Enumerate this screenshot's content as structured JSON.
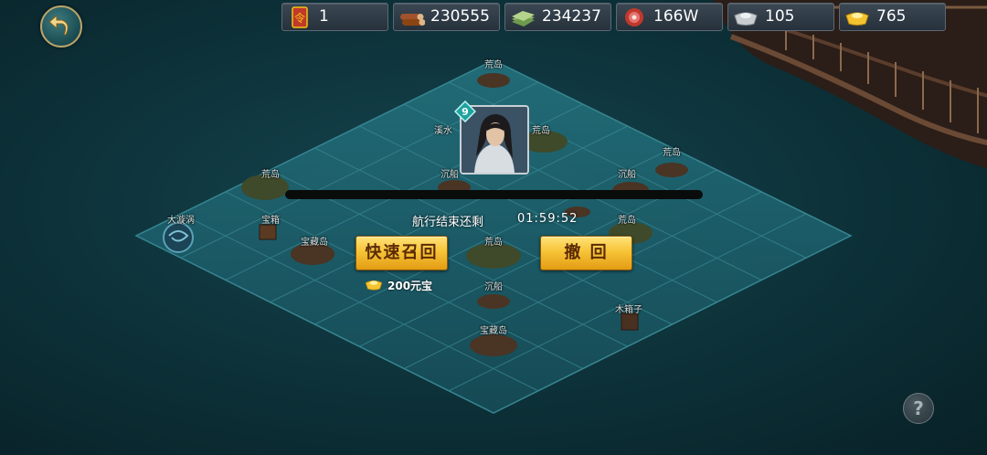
{
  "resources": [
    {
      "icon": "order-token-icon",
      "value": "1"
    },
    {
      "icon": "wood-logs-icon",
      "value": "230555"
    },
    {
      "icon": "cash-stack-icon",
      "value": "234237"
    },
    {
      "icon": "meat-icon",
      "value": "166W"
    },
    {
      "icon": "silver-ingot-icon",
      "value": "105"
    },
    {
      "icon": "gold-ingot-icon",
      "value": "765"
    }
  ],
  "voyage": {
    "timer_label": "航行结束还剩",
    "timer_value": "01:59:52"
  },
  "actions": {
    "quick_recall_label": "快速召回",
    "withdraw_label": "撤 回",
    "quick_recall_cost": "200元宝"
  },
  "hero": {
    "level": "9"
  },
  "map_labels": [
    "荒岛",
    "溪水",
    "荒岛",
    "宝箱",
    "沉船",
    "荒岛",
    "大漩涡",
    "宝箱",
    "宝藏岛",
    "沉船",
    "荒岛",
    "荒岛",
    "荒岛",
    "沉船",
    "木箱子",
    "宝藏岛"
  ],
  "help": {
    "label": "?"
  },
  "colors": {
    "sea": "#0e343c",
    "tile": "#1d5d6a",
    "button_gold": "#f7c437",
    "button_text": "#5a2a05"
  }
}
